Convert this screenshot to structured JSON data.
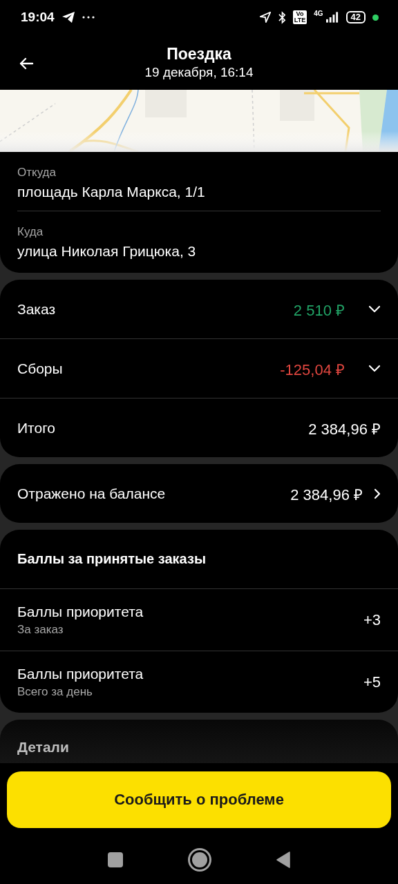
{
  "status_bar": {
    "time": "19:04",
    "volte": [
      "Vo",
      "LTE"
    ],
    "network": "4G",
    "battery": "42"
  },
  "header": {
    "title": "Поездка",
    "subtitle": "19 декабря, 16:14"
  },
  "route": [
    {
      "label": "Откуда",
      "value": "площадь Карла Маркса, 1/1"
    },
    {
      "label": "Куда",
      "value": "улица Николая Грицюка, 3"
    }
  ],
  "payment": [
    {
      "kind": "expandable",
      "label": "Заказ",
      "amount": "2 510 ₽",
      "color": "#21a366",
      "expanded": false
    },
    {
      "kind": "expandable",
      "label": "Сборы",
      "amount": "-125,04 ₽",
      "color": "#e0463f",
      "expanded": false
    },
    {
      "kind": "plain",
      "label": "Итого",
      "amount": "2 384,96 ₽",
      "color": "#ffffff"
    }
  ],
  "balance": {
    "label": "Отражено на балансе",
    "amount": "2 384,96 ₽"
  },
  "points": {
    "title": "Баллы за принятые заказы",
    "rows": [
      {
        "label": "Баллы приоритета",
        "sublabel": "За заказ",
        "value": "+3"
      },
      {
        "label": "Баллы приоритета",
        "sublabel": "Всего за день",
        "value": "+5"
      }
    ]
  },
  "details": {
    "title": "Детали"
  },
  "report_button": "Сообщить о проблеме"
}
